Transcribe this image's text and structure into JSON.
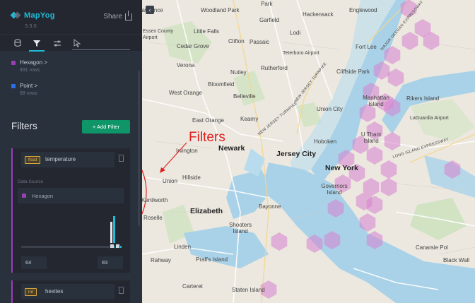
{
  "app": {
    "name": "MapYog",
    "version": "3.3.0",
    "share_label": "Share"
  },
  "tabs": [
    {
      "name": "layers",
      "icon": "layers-icon"
    },
    {
      "name": "filters",
      "icon": "filter-icon",
      "active": true
    },
    {
      "name": "interactions",
      "icon": "sliders-icon"
    },
    {
      "name": "base-map",
      "icon": "cursor-icon"
    }
  ],
  "layers": [
    {
      "label": "Hexagon >",
      "rows": "491 rows",
      "color": "#9b3fb5"
    },
    {
      "label": "Point >",
      "rows": "68 rows",
      "color": "#2a6fe8"
    }
  ],
  "filters_panel": {
    "title": "Filters",
    "add_filter_label": "+ Add Filter"
  },
  "filters": [
    {
      "type": "float",
      "field": "temperature",
      "data_source_label": "Data Source",
      "data_source": "Hexagon",
      "range_min": "64",
      "range_max": "83"
    },
    {
      "type": "int",
      "field": "hexites"
    }
  ],
  "annotation": {
    "text": "Filters",
    "color": "#e0201f"
  },
  "map_labels": {
    "cities": [
      "Newark",
      "Jersey City",
      "New York",
      "Elizabeth"
    ],
    "towns": [
      "Woodland Park",
      "Park",
      "Hackensack",
      "Englewood",
      "Essex County Airport",
      "Little Falls",
      "Garfield",
      "Lodi",
      "Cedar Grove",
      "Clifton",
      "Passaic",
      "Teterboro Airport",
      "Fort Lee",
      "Verona",
      "Nutley",
      "Rutherford",
      "Cliffside Park",
      "Bloomfield",
      "West Orange",
      "Belleville",
      "Union City",
      "Manhattan Island",
      "Rikers Island",
      "East Orange",
      "Kearny",
      "LaGuardia Airport",
      "Hoboken",
      "U Thant Island",
      "Irvington",
      "Union",
      "Hillside",
      "Governors Island",
      "Bayonne",
      "Shooters Island",
      "Linden",
      "Rahway",
      "Prall's Island",
      "Carteret",
      "Staten Island",
      "Canarsie Pol",
      "Black Wall",
      "Roselle",
      "Kenilworth",
      "Lawrence"
    ],
    "roads": [
      "NEW JERSEY TURNPIKE",
      "BROOKLYN QUEENS EXPRESSWAY",
      "LONG ISLAND EXPRESSWAY",
      "MAJOR DEEGAN EXPRESSWAY"
    ]
  }
}
